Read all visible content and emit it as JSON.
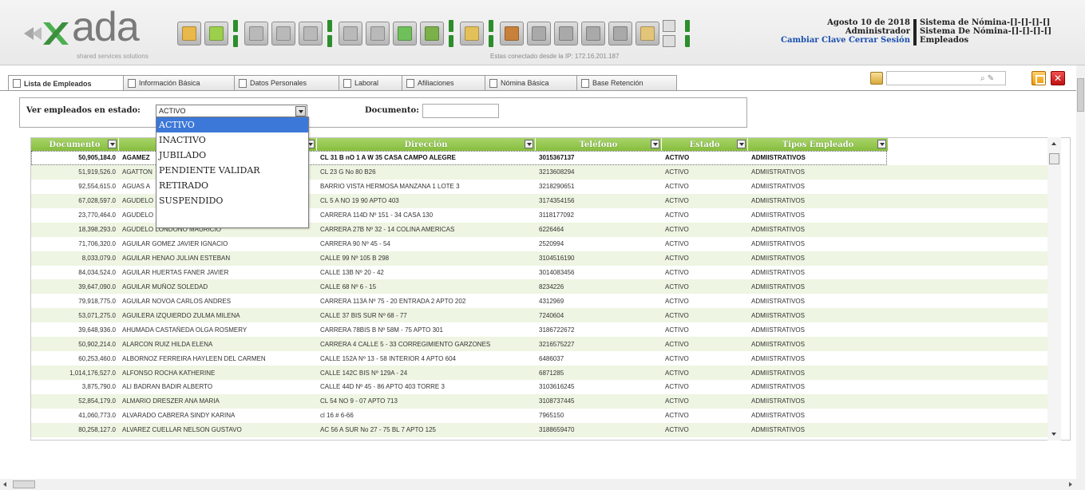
{
  "header": {
    "logo_text": "ada",
    "logo_tagline": "shared services solutions",
    "ip_text": "Estas conectado desde la IP: 172.16.201.187",
    "date": "Agosto 10 de 2018",
    "role": "Administrador",
    "change_password": "Cambiar Clave",
    "logout": "Cerrar Sesión",
    "system_line1": "Sistema de Nómina-[]-[]-[]-[]",
    "system_line2": "Sistema De Nómina-[]-[]-[]-[]",
    "module": "Empleados"
  },
  "toolbar": {
    "buttons": [
      {
        "icon": "folder-open-icon",
        "color": "#e8b84a"
      },
      {
        "icon": "new-document-icon",
        "color": "#9ccf4b"
      },
      {
        "icon": "save-icon",
        "color": "#b9b9b9"
      },
      {
        "icon": "delete-icon",
        "color": "#b9b9b9"
      },
      {
        "icon": "undo-icon",
        "color": "#b9b9b9"
      },
      {
        "icon": "print-icon",
        "color": "#b9b9b9"
      },
      {
        "icon": "search-preview-icon",
        "color": "#b9b9b9"
      },
      {
        "icon": "export-excel-icon",
        "color": "#6fbf5a"
      },
      {
        "icon": "import-icon",
        "color": "#7bb04a"
      },
      {
        "icon": "lock-icon",
        "color": "#e4c05a"
      },
      {
        "icon": "report-brown-icon",
        "color": "#c8813a"
      },
      {
        "icon": "report-gray-icon",
        "color": "#a9a9a9"
      },
      {
        "icon": "grid-icon",
        "color": "#a9a9a9"
      },
      {
        "icon": "cart-icon",
        "color": "#a9a9a9"
      },
      {
        "icon": "settings-icon",
        "color": "#a9a9a9"
      },
      {
        "icon": "calendar-icon",
        "color": "#e3c57a"
      }
    ]
  },
  "search": {
    "placeholder": ""
  },
  "tabs": [
    {
      "label": "Lista de Empleados",
      "active": true
    },
    {
      "label": "Información Básica",
      "active": false
    },
    {
      "label": "Datos Personales",
      "active": false
    },
    {
      "label": "Laboral",
      "active": false
    },
    {
      "label": "Afiliaciones",
      "active": false
    },
    {
      "label": "Nómina Básica",
      "active": false
    },
    {
      "label": "Base Retención",
      "active": false
    }
  ],
  "filter": {
    "estado_label": "Ver empleados en estado:",
    "estado_value": "ACTIVO",
    "documento_label": "Documento:",
    "documento_value": ""
  },
  "dropdown": {
    "options": [
      "ACTIVO",
      "INACTIVO",
      "JUBILADO",
      "PENDIENTE VALIDAR",
      "RETIRADO",
      "SUSPENDIDO"
    ],
    "selected": "ACTIVO"
  },
  "grid": {
    "headers": [
      "Documento",
      "",
      "Dirección",
      "Teléfono",
      "Estado",
      "Tipos Empleado"
    ],
    "rows": [
      [
        "50,905,184.0",
        "AGAMEZ",
        "CL 31 B nO 1 A W 35 CASA CAMPO ALEGRE",
        "3015367137",
        "ACTIVO",
        "ADMIISTRATIVOS"
      ],
      [
        "51,919,526.0",
        "AGATTON",
        "CL 23 G No 80 B26",
        "3213608294",
        "ACTIVO",
        "ADMIISTRATIVOS"
      ],
      [
        "92,554,615.0",
        "AGUAS A",
        "BARRIO VISTA HERMOSA MANZANA 1 LOTE 3",
        "3218290651",
        "ACTIVO",
        "ADMIISTRATIVOS"
      ],
      [
        "67,028,597.0",
        "AGUDELO",
        "CL 5 A NO 19 90 APTO 403",
        "3174354156",
        "ACTIVO",
        "ADMIISTRATIVOS"
      ],
      [
        "23,770,464.0",
        "AGUDELO",
        "CARRERA 114D Nº 151 - 34 CASA 130",
        "3118177092",
        "ACTIVO",
        "ADMIISTRATIVOS"
      ],
      [
        "18,398,293.0",
        "AGUDELO LONDONO MAURICIO",
        "CARRERA 27B Nº 32 - 14 COLINA AMERICAS",
        "6226464",
        "ACTIVO",
        "ADMIISTRATIVOS"
      ],
      [
        "71,706,320.0",
        "AGUILAR GOMEZ JAVIER IGNACIO",
        "CARRERA 90 Nº 45 - 54",
        "2520994",
        "ACTIVO",
        "ADMIISTRATIVOS"
      ],
      [
        "8,033,079.0",
        "AGUILAR HENAO JULIAN ESTEBAN",
        "CALLE 99 Nº 105 B 298",
        "3104516190",
        "ACTIVO",
        "ADMIISTRATIVOS"
      ],
      [
        "84,034,524.0",
        "AGUILAR HUERTAS FANER JAVIER",
        "CALLE 13B Nº 20 - 42",
        "3014083456",
        "ACTIVO",
        "ADMIISTRATIVOS"
      ],
      [
        "39,647,090.0",
        "AGUILAR MUÑOZ SOLEDAD",
        "CALLE 68 Nº 6 - 15",
        "8234226",
        "ACTIVO",
        "ADMIISTRATIVOS"
      ],
      [
        "79,918,775.0",
        "AGUILAR NOVOA CARLOS ANDRES",
        "CARRERA 113A Nº 75 - 20 ENTRADA 2 APTO 202",
        "4312969",
        "ACTIVO",
        "ADMIISTRATIVOS"
      ],
      [
        "53,071,275.0",
        "AGUILERA IZQUIERDO ZULMA MILENA",
        "CALLE 37 BIS SUR Nº 68 - 77",
        "7240604",
        "ACTIVO",
        "ADMIISTRATIVOS"
      ],
      [
        "39,648,936.0",
        "AHUMADA CASTAÑEDA OLGA ROSMERY",
        "CARRERA 78BIS B Nº 58M - 75 APTO 301",
        "3186722672",
        "ACTIVO",
        "ADMIISTRATIVOS"
      ],
      [
        "50,902,214.0",
        "ALARCON RUIZ HILDA ELENA",
        "CARRERA 4 CALLE 5 - 33 CORREGIMIENTO GARZONES",
        "3216575227",
        "ACTIVO",
        "ADMIISTRATIVOS"
      ],
      [
        "60,253,460.0",
        "ALBORNOZ FERREIRA HAYLEEN DEL CARMEN",
        "CALLE 152A Nº 13 - 58 INTERIOR 4 APTO 604",
        "6486037",
        "ACTIVO",
        "ADMIISTRATIVOS"
      ],
      [
        "1,014,176,527.0",
        "ALFONSO ROCHA KATHERINE",
        "CALLE 142C BIS Nº 129A - 24",
        "6871285",
        "ACTIVO",
        "ADMIISTRATIVOS"
      ],
      [
        "3,875,790.0",
        "ALI BADRAN BADIR ALBERTO",
        "CALLE 44D Nº 45 - 86 APTO 403 TORRE 3",
        "3103616245",
        "ACTIVO",
        "ADMIISTRATIVOS"
      ],
      [
        "52,854,179.0",
        "ALMARIO DRESZER ANA MARIA",
        "CL 54 NO 9 - 07 APTO 713",
        "3108737445",
        "ACTIVO",
        "ADMIISTRATIVOS"
      ],
      [
        "41,060,773.0",
        "ALVARADO CABRERA SINDY KARINA",
        "cl 16 # 6-66",
        "7965150",
        "ACTIVO",
        "ADMIISTRATIVOS"
      ],
      [
        "80,258,127.0",
        "ALVAREZ CUELLAR NELSON GUSTAVO",
        "AC 56 A SUR No 27 - 75 BL 7 APTO 125",
        "3188659470",
        "ACTIVO",
        "ADMIISTRATIVOS"
      ]
    ]
  }
}
